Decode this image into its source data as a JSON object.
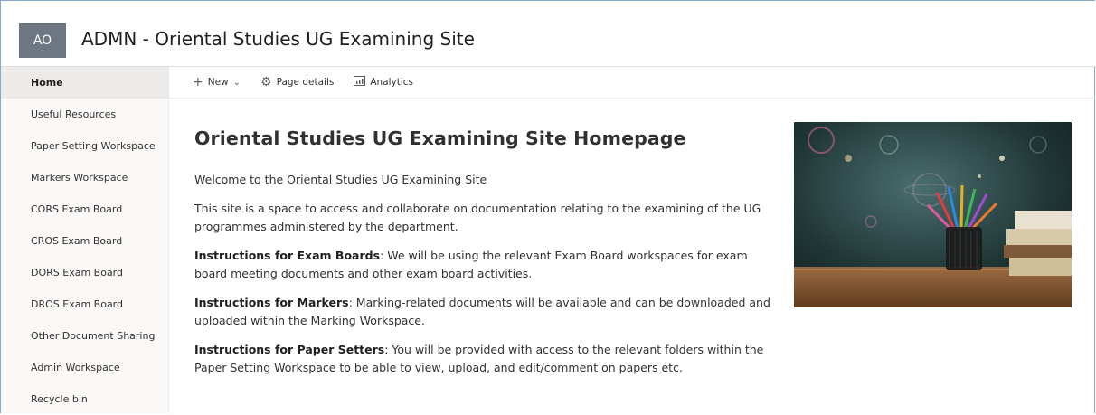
{
  "site": {
    "initials": "AO",
    "title": "ADMN - Oriental Studies UG Examining Site"
  },
  "sidebar": {
    "items": [
      {
        "label": "Home",
        "active": true
      },
      {
        "label": "Useful Resources"
      },
      {
        "label": "Paper Setting Workspace"
      },
      {
        "label": "Markers Workspace"
      },
      {
        "label": "CORS Exam Board"
      },
      {
        "label": "CROS Exam Board"
      },
      {
        "label": "DORS Exam Board"
      },
      {
        "label": "DROS Exam Board"
      },
      {
        "label": "Other Document Sharing"
      },
      {
        "label": "Admin Workspace"
      },
      {
        "label": "Recycle bin"
      }
    ]
  },
  "toolbar": {
    "new_label": "New",
    "page_details_label": "Page details",
    "analytics_label": "Analytics"
  },
  "main": {
    "heading": "Oriental Studies UG Examining Site Homepage",
    "welcome": "Welcome to the Oriental Studies UG Examining Site",
    "intro": "This site is a space to access and collaborate on documentation relating to the examining of the UG programmes administered by the department.",
    "exam_boards_title": "Instructions for Exam Boards",
    "exam_boards_text": ": We will be using the relevant Exam Board workspaces for exam board meeting documents and other exam board activities.",
    "markers_title": "Instructions for Markers",
    "markers_text": ": Marking-related documents will be available and can be downloaded and uploaded within the Marking Workspace.",
    "setters_title": "Instructions for Paper Setters",
    "setters_text": ": You will be provided with access to the relevant folders within the Paper Setting Workspace to be able to view, upload, and edit/comment on papers etc."
  }
}
